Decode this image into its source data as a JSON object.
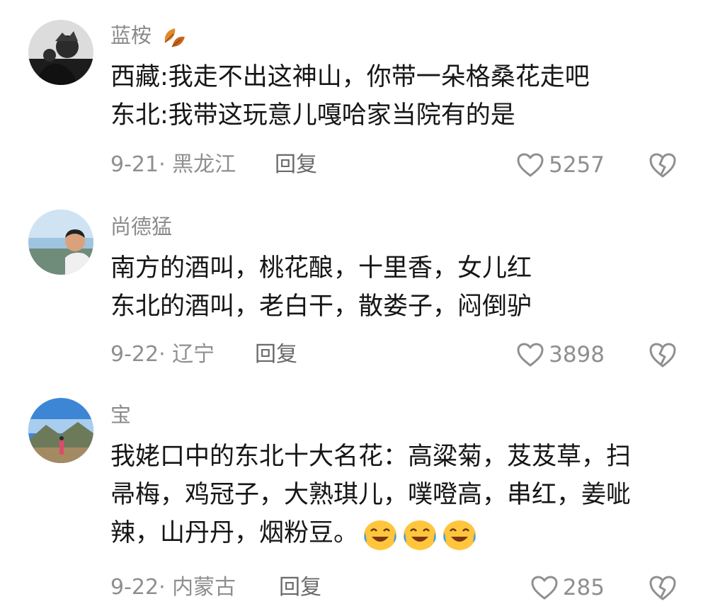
{
  "comments": [
    {
      "username": "蓝桉",
      "text_lines": [
        "西藏:我走不出这神山，你带一朵格桑花走吧",
        "东北:我带这玩意儿嘎哈家当院有的是"
      ],
      "date_location": "9-21· 黑龙江",
      "reply_label": "回复",
      "likes": "5257",
      "avatar_icon": "bw-cartoon-avatar",
      "badge_icon": "autumn-leaf-icon"
    },
    {
      "username": "尚德猛",
      "text_lines": [
        "南方的酒叫，桃花酿，十里香，女儿红",
        "东北的酒叫，老白干，散娄子，闷倒驴"
      ],
      "date_location": "9-22· 辽宁",
      "reply_label": "回复",
      "likes": "3898",
      "avatar_icon": "man-photo-avatar"
    },
    {
      "username": "宝",
      "text_lines": [
        "我姥口中的东北十大名花：高粱菊，芨芨草，扫",
        "帚梅，鸡冠子，大熟琪儿，噗噔高，串红，姜呲",
        "辣，山丹丹，烟粉豆。"
      ],
      "emoji_icons": [
        "crying-laughing-emoji",
        "crying-laughing-emoji",
        "crying-laughing-emoji"
      ],
      "date_location": "9-22· 内蒙古",
      "reply_label": "回复",
      "likes": "285",
      "avatar_icon": "landscape-photo-avatar"
    }
  ],
  "icons": {
    "like": "heart-outline-icon",
    "dislike": "broken-heart-icon"
  },
  "colors": {
    "username": "#8a8a8a",
    "text": "#161616",
    "meta": "#8f8f8f"
  }
}
